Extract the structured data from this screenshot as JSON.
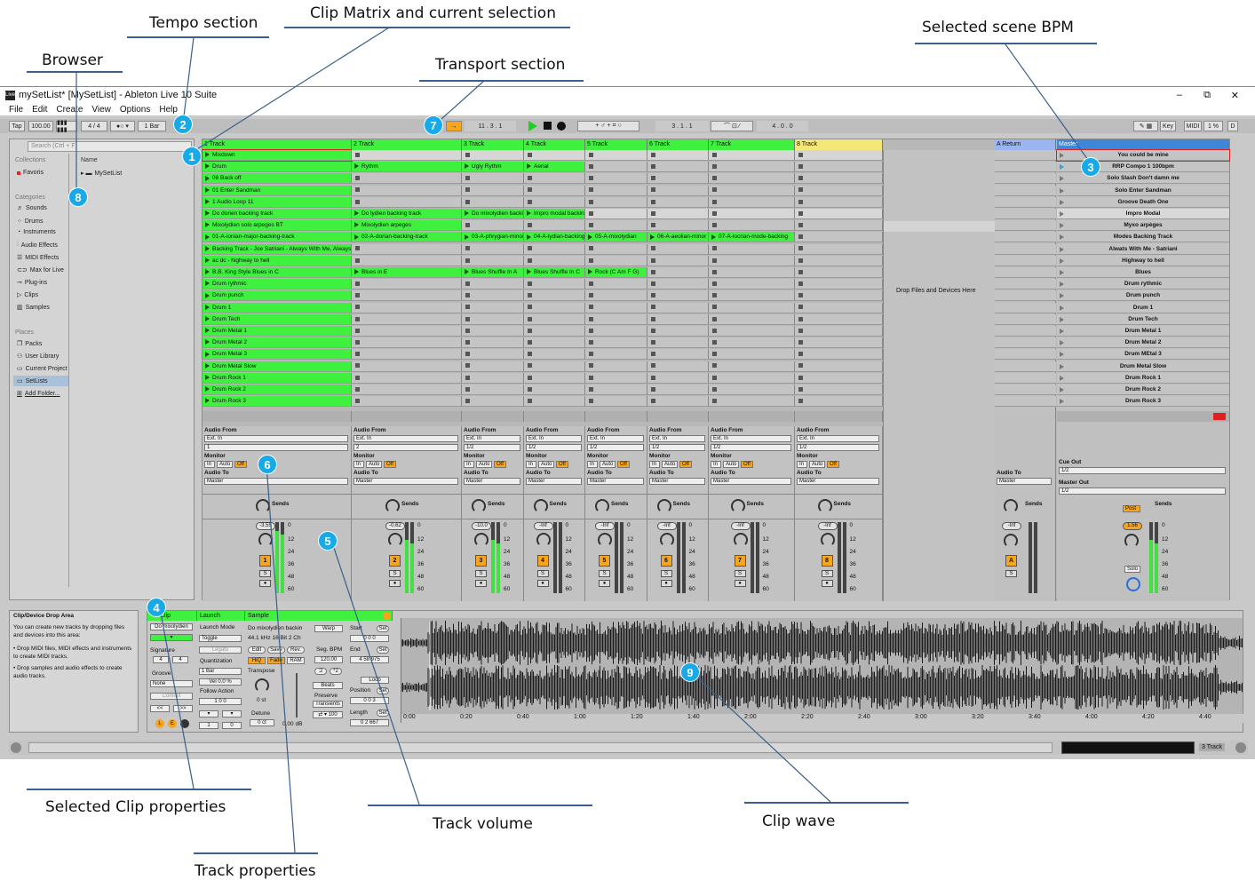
{
  "annotations": {
    "tempo": "Tempo section",
    "clip_matrix": "Clip Matrix and current selection",
    "scene_bpm": "Selected scene BPM",
    "browser": "Browser",
    "transport": "Transport section",
    "clip_props": "Selected Clip properties",
    "track_volume": "Track volume",
    "clip_wave": "Clip wave",
    "track_props": "Track properties"
  },
  "badges": [
    "1",
    "2",
    "3",
    "4",
    "5",
    "6",
    "7",
    "8",
    "9"
  ],
  "window": {
    "title": "mySetList* [MySetList] - Ableton Live 10 Suite",
    "controls": [
      "–",
      "⧉",
      "✕"
    ]
  },
  "menu": [
    "File",
    "Edit",
    "Create",
    "View",
    "Options",
    "Help"
  ],
  "toolbar": {
    "tap": "Tap",
    "tempo": "100.00",
    "signature": "4 / 4",
    "quantize": "1 Bar",
    "position": "11 . 3 . 1",
    "loop_start": "3 . 1 . 1",
    "loop_length": "4 . 0 . 0",
    "key": "Key",
    "midi": "MIDI",
    "cpu": "1 %",
    "d": "D"
  },
  "browser": {
    "search_placeholder": "Search (Ctrl + F)",
    "collections_label": "Collections",
    "favorites": "Favoris",
    "name_col": "Name",
    "root_item": "MySetList",
    "categories_label": "Categories",
    "categories": [
      "Sounds",
      "Drums",
      "Instruments",
      "Audio Effects",
      "MIDI Effects",
      "Max for Live",
      "Plug-ins",
      "Clips",
      "Samples"
    ],
    "places_label": "Places",
    "places": [
      "Packs",
      "User Library",
      "Current Project",
      "SetLists",
      "Add Folder..."
    ]
  },
  "tracks": [
    {
      "name": "1 Track",
      "clips": [
        "Mixdown",
        "Drum",
        "08 Back off",
        "01 Enter Sandman",
        "1 Audio Loop 11",
        "Do dorien backing track",
        "Mixolydien solo arpeges BT",
        "01-A-ionian-major-backing-track",
        "Backing Track - Joe Satriani - Always With Me, Always With You",
        "ac dc - highway to hell",
        "B.B. King Style Blues in C",
        "Drum rythmic",
        "Drum punch",
        "Drum 1",
        "Drum Tech",
        "Drum Metal 1",
        "Drum Metal 2",
        "Drum Metal 3",
        "Drum Metal Slow",
        "Drum Rock 1",
        "Drum Rock 2",
        "Drum Rock 3"
      ],
      "vol": "-3.55",
      "num": "1",
      "io_in": "1",
      "foot": "1"
    },
    {
      "name": "2 Track",
      "clips": [
        "",
        "Rythm",
        "",
        "",
        "",
        "Do lydien backing track",
        "Mixolydien arpeges",
        "02-A-dorian-backing-track",
        "",
        "",
        "Blues in E",
        "",
        "",
        "",
        "",
        "",
        "",
        "",
        "",
        "",
        "",
        ""
      ],
      "vol": "-0.62",
      "num": "2",
      "io_in": "2",
      "foot_a": "1",
      "foot_b": "32"
    },
    {
      "name": "3 Track",
      "clips": [
        "",
        "Ugly Rythm",
        "",
        "",
        "",
        "Do mixolydien backing",
        "",
        "03-A-phrygian-minor",
        "",
        "",
        "Blues Shuffle In A",
        "",
        "",
        "",
        "",
        "",
        "",
        "",
        "",
        "",
        "",
        ""
      ],
      "vol": "-10.0",
      "num": "3",
      "io_in": "1/2",
      "foot": "4:48"
    },
    {
      "name": "4 Track",
      "clips": [
        "",
        "Aerial",
        "",
        "",
        "",
        "Impro modal backing",
        "",
        "04-A-lydian-backing",
        "",
        "",
        "Blues Shuffle In C",
        "",
        "",
        "",
        "",
        "",
        "",
        "",
        "",
        "",
        "",
        ""
      ],
      "vol": "-Inf",
      "num": "4",
      "io_in": "1/2"
    },
    {
      "name": "5 Track",
      "clips": [
        "",
        "",
        "",
        "",
        "",
        "",
        "",
        "05-A-mixolydian",
        "",
        "",
        "Rock (C Am F G)",
        "",
        "",
        "",
        "",
        "",
        "",
        "",
        "",
        "",
        "",
        ""
      ],
      "vol": "-Inf",
      "num": "5",
      "io_in": "1/2"
    },
    {
      "name": "6 Track",
      "clips": [
        "",
        "",
        "",
        "",
        "",
        "",
        "",
        "06-A-aeolian-minor",
        "",
        "",
        "",
        "",
        "",
        "",
        "",
        "",
        "",
        "",
        "",
        "",
        "",
        ""
      ],
      "vol": "-Inf",
      "num": "6",
      "io_in": "1/2"
    },
    {
      "name": "7 Track",
      "clips": [
        "",
        "",
        "",
        "",
        "",
        "",
        "",
        "07-A-locrian-mode-backing",
        "",
        "",
        "",
        "",
        "",
        "",
        "",
        "",
        "",
        "",
        "",
        "",
        "",
        ""
      ],
      "vol": "-Inf",
      "num": "7",
      "io_in": "1/2"
    },
    {
      "name": "8 Track",
      "clips": [
        "",
        "",
        "",
        "",
        "",
        "",
        "",
        "",
        "",
        "",
        "",
        "",
        "",
        "",
        "",
        "",
        "",
        "",
        "",
        "",
        "",
        ""
      ],
      "vol": "-Inf",
      "num": "8",
      "io_in": "1/2"
    }
  ],
  "drop_zone": "Drop Files and Devices Here",
  "return_track": {
    "name": "A Return",
    "vol": "-Inf",
    "num": "A",
    "audio_to_label": "Audio To",
    "audio_to": "Master"
  },
  "master": {
    "name": "Master",
    "vol": "1.56",
    "scenes": [
      "You could be mine",
      "RRP Compo 1 100bpm",
      "Solo Slash Don't damn me",
      "Solo Enter Sandman",
      "Groove Death One",
      "Impro Modal",
      "Myxo arpèges",
      "Modes Backing Track",
      "Alwats With Me - Satriani",
      "Highway to hell",
      "Blues",
      "Drum rythmic",
      "Drum punch",
      "Drum 1",
      "Drum Tech",
      "Drum Metal 1",
      "Drum Metal 2",
      "Drum MEtal 3",
      "Drum Metal Slow",
      "Drum Rock 1",
      "Drum Rock 2",
      "Drum Rock 3"
    ],
    "cue_out_label": "Cue Out",
    "cue_out": "1/2",
    "master_out_label": "Master Out",
    "master_out": "1/2",
    "post": "Post",
    "solo": "Solo"
  },
  "io_labels": {
    "audio_from": "Audio From",
    "ext_in": "Ext. In",
    "monitor": "Monitor",
    "in": "In",
    "auto": "Auto",
    "off": "Off",
    "audio_to": "Audio To",
    "master": "Master",
    "sends": "Sends"
  },
  "meter_scale": [
    "0",
    "12",
    "24",
    "36",
    "48",
    "60"
  ],
  "info_panel": {
    "title": "Clip/Device Drop Area",
    "body": "You can create new tracks by dropping files and devices into this area:",
    "bullets": [
      "Drop MIDI files, MIDI effects and instruments to create MIDI tracks.",
      "Drop samples and audio effects to create audio tracks."
    ]
  },
  "clip_view": {
    "clip_tab": "Clip",
    "clip_name": "Do mixolydien",
    "signature_label": "Signature",
    "sig_num": "4",
    "sig_den": "4",
    "groove_label": "Groove",
    "groove_val": "None",
    "commit": "Commit",
    "launch_tab": "Launch",
    "launch_mode_label": "Launch Mode",
    "launch_mode": "Toggle",
    "legato": "Legato",
    "quantization_label": "Quantization",
    "quantization": "1 Bar",
    "velocity": "Vel  0.0 %",
    "follow_label": "Follow Action",
    "sample_tab": "Sample",
    "sample_name": "Do mixolydien backin",
    "sample_info": "44.1 kHz 16 Bit 2 Ch",
    "warp": "Warp",
    "edit": "Edit",
    "save": "Save",
    "rev": "Rev.",
    "hiq": "HiQ",
    "fade": "Fade",
    "ram": "RAM",
    "transpose_label": "Transpose",
    "transpose_val": "0 st",
    "detune_label": "Detune",
    "detune_val": "0 ct",
    "gain_val": "0.00 dB",
    "seg_bpm_label": "Seg. BPM",
    "seg_bpm": "120.00",
    "beats": "Beats",
    "preserve_label": "Preserve",
    "transients": "Transients",
    "start_label": "Start",
    "end_label": "End",
    "loop": "Loop",
    "position_label": "Position",
    "length_label": "Length",
    "set": "Set",
    "end_val": "4  58  975",
    "length_val": "0  2  667"
  },
  "timeline": [
    "0:00",
    "0:20",
    "0:40",
    "1:00",
    "1:20",
    "1:40",
    "2:00",
    "2:20",
    "2:40",
    "3:00",
    "3:20",
    "3:40",
    "4:00",
    "4:20",
    "4:40"
  ],
  "status_bar": {
    "track_label": "3 Track"
  }
}
